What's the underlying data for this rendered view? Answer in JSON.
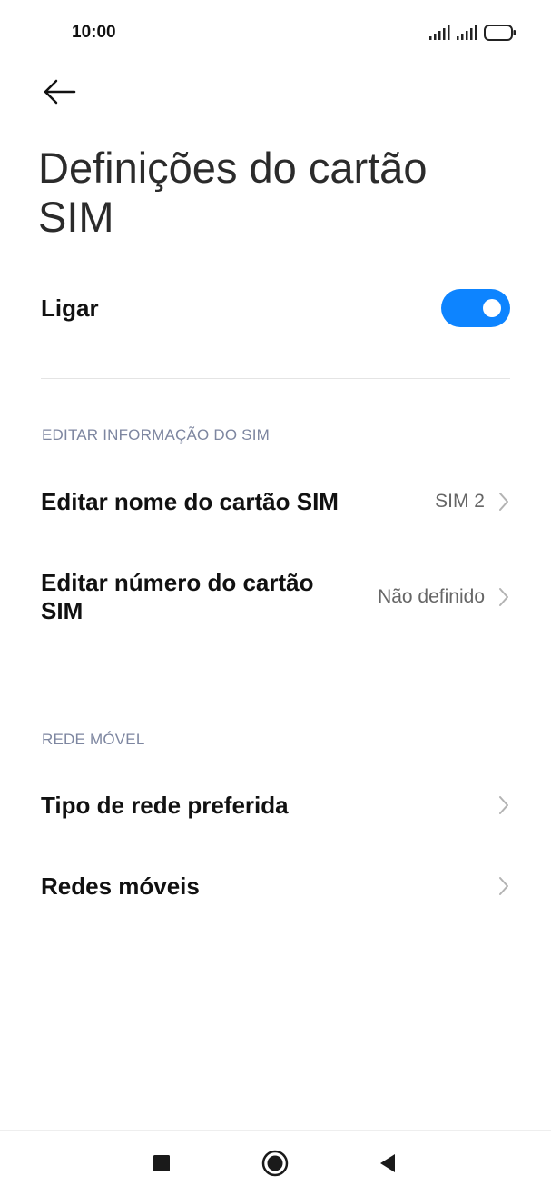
{
  "status_bar": {
    "time": "10:00",
    "icons": [
      "signal-icon",
      "signal-icon",
      "battery-icon"
    ]
  },
  "header": {
    "back_icon": "arrow-left-icon",
    "title": "Definições do cartão SIM"
  },
  "power": {
    "label": "Ligar",
    "enabled": true,
    "accent_color": "#0d84ff"
  },
  "sections": {
    "edit_sim": {
      "header": "EDITAR INFORMAÇÃO DO SIM",
      "items": [
        {
          "label": "Editar nome do cartão SIM",
          "value": "SIM 2"
        },
        {
          "label": "Editar número do cartão SIM",
          "value": "Não definido"
        }
      ]
    },
    "mobile_network": {
      "header": "REDE MÓVEL",
      "items": [
        {
          "label": "Tipo de rede preferida"
        },
        {
          "label": "Redes móveis"
        }
      ]
    }
  },
  "nav_bar": {
    "buttons": [
      "recents-square-icon",
      "home-circle-icon",
      "back-triangle-icon"
    ]
  }
}
